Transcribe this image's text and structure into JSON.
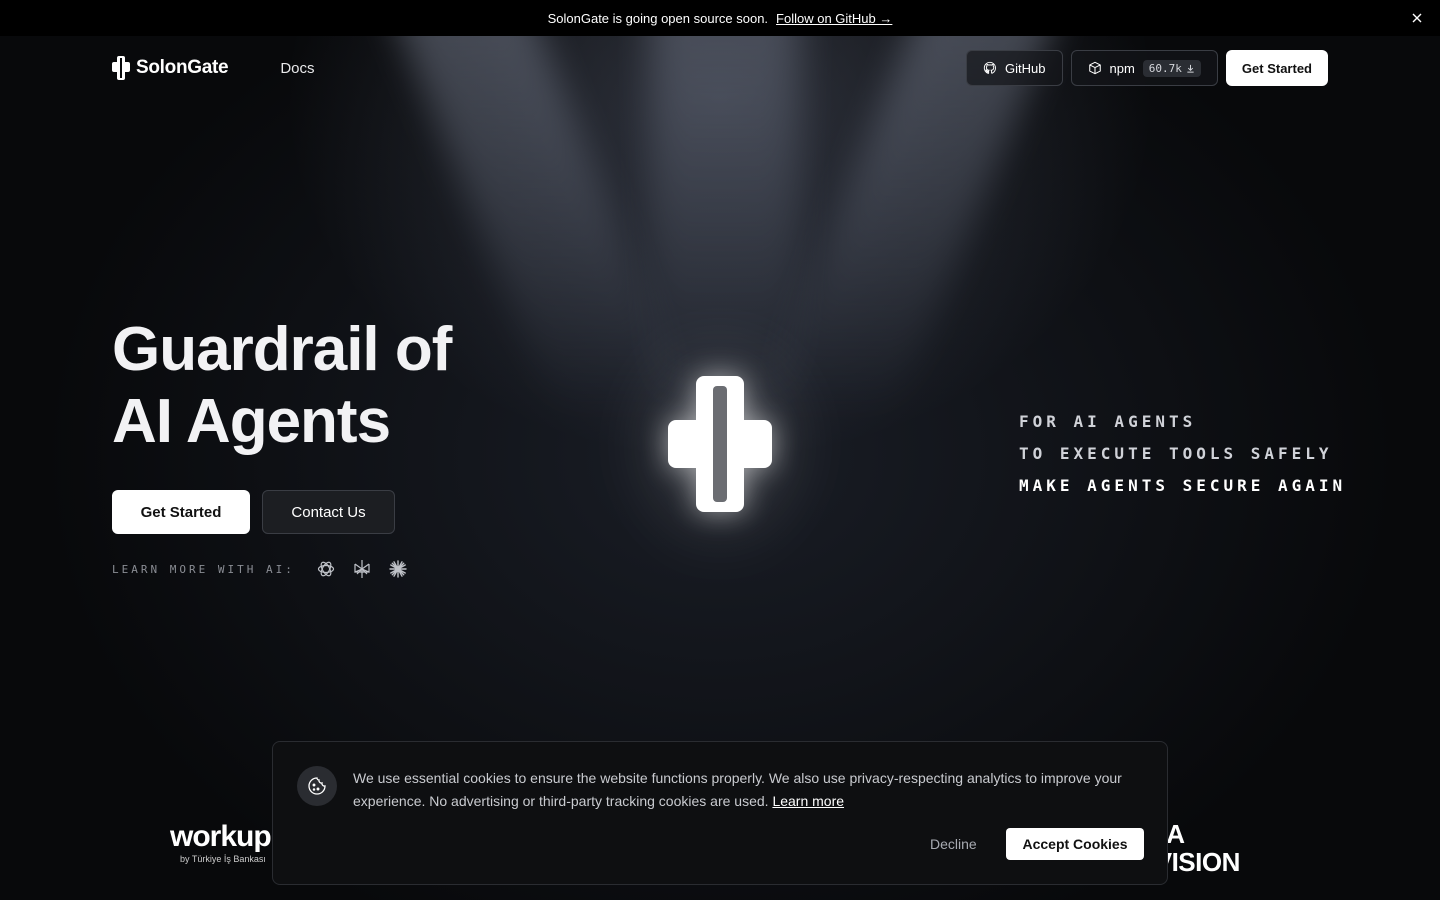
{
  "announcement": {
    "text": "SolonGate is going open source soon.",
    "link": "Follow on GitHub →",
    "close_icon": "close-icon"
  },
  "nav": {
    "brand": "SolonGate",
    "docs": "Docs",
    "github": "GitHub",
    "npm": "npm",
    "npm_downloads": "60.7k",
    "get_started": "Get Started"
  },
  "hero": {
    "title_line1": "Guardrail of",
    "title_line2": "AI Agents",
    "cta_primary": "Get Started",
    "cta_secondary": "Contact Us",
    "learn_label": "LEARN MORE WITH AI:",
    "ai_icons": [
      "openai-icon",
      "perplexity-icon",
      "claude-icon"
    ]
  },
  "taglines": [
    "FOR AI AGENTS",
    "TO EXECUTE TOOLS SAFELY",
    "MAKE AGENTS SECURE AGAIN"
  ],
  "logos": {
    "workup_name": "workup",
    "workup_sub": "by Türkiye İş Bankası",
    "right_line1": "RA",
    "right_line2": "IVISION"
  },
  "cookie": {
    "text": "We use essential cookies to ensure the website functions properly. We also use privacy-respecting analytics to improve your experience. No advertising or third-party tracking cookies are used.",
    "learn_more": "Learn more",
    "decline": "Decline",
    "accept": "Accept Cookies"
  },
  "colors": {
    "background": "#08090b",
    "accent": "#ffffff",
    "muted": "#8a8d94"
  }
}
